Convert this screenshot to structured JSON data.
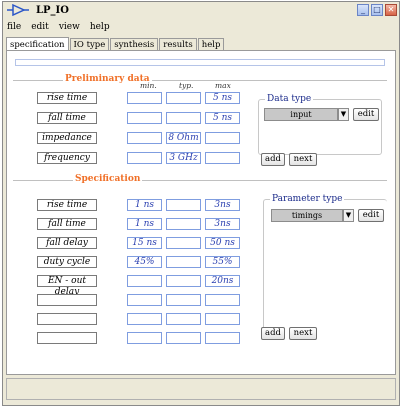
{
  "window": {
    "title": "LP_IO"
  },
  "menu": [
    "file",
    "edit",
    "view",
    "help"
  ],
  "tabs": [
    "specification",
    "IO type",
    "synthesis",
    "results",
    "help"
  ],
  "columns": {
    "min": "min.",
    "typ": "typ.",
    "max": "max"
  },
  "preliminary": {
    "title": "Preliminary data",
    "rows": [
      {
        "label": "rise time",
        "min": "",
        "typ": "",
        "max": "5 ns"
      },
      {
        "label": "fall time",
        "min": "",
        "typ": "",
        "max": "5 ns"
      },
      {
        "label": "impedance",
        "min": "",
        "typ": "8 Ohm",
        "max": ""
      },
      {
        "label": "frequency",
        "min": "",
        "typ": "3 GHz",
        "max": ""
      }
    ],
    "group_title": "Data type",
    "select_value": "input",
    "edit_label": "edit",
    "add_label": "add",
    "next_label": "next"
  },
  "specification": {
    "title": "Specification",
    "rows": [
      {
        "label": "rise time",
        "min": "1 ns",
        "typ": "",
        "max": "3ns"
      },
      {
        "label": "fall time",
        "min": "1 ns",
        "typ": "",
        "max": "3ns"
      },
      {
        "label": "fall delay",
        "min": "15 ns",
        "typ": "",
        "max": "50 ns"
      },
      {
        "label": "duty cycle",
        "min": "45%",
        "typ": "",
        "max": "55%"
      },
      {
        "label": "EN - out delay",
        "min": "",
        "typ": "",
        "max": "20ns"
      },
      {
        "label": "",
        "min": "",
        "typ": "",
        "max": ""
      },
      {
        "label": "",
        "min": "",
        "typ": "",
        "max": ""
      },
      {
        "label": "",
        "min": "",
        "typ": "",
        "max": ""
      }
    ],
    "group_title": "Parameter type",
    "select_value": "timings",
    "edit_label": "edit",
    "add_label": "add",
    "next_label": "next"
  }
}
